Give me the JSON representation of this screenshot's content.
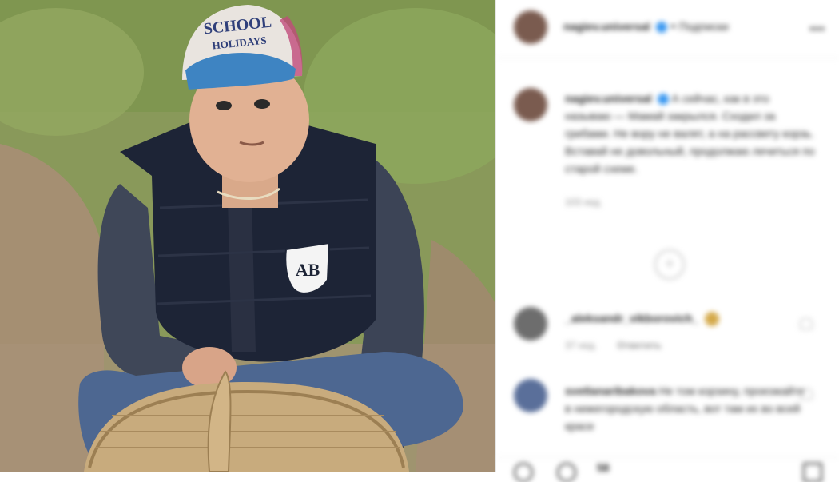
{
  "photo": {
    "cap_text_line1": "SCHOOL",
    "cap_text_line2": "HOLIDAYS",
    "vest_badge": "AB"
  },
  "header": {
    "username": "nagiev.universal",
    "separator": "•",
    "follow_label": "Подписки",
    "more_label": "•••"
  },
  "caption": {
    "username": "nagiev.universal",
    "text": "А сейчас, как в это называю — Мамай закрылся. Сходил за грибами. Не вору не валят, а на рассвету корзь. Вставай не довольный, продолжаю лечиться по старой схеме.",
    "time": "103 нед."
  },
  "load_more": "+",
  "comments": [
    {
      "username": "_aleksandr_vikborovich_",
      "text": "",
      "time": "37 нед.",
      "reply": "Ответить"
    },
    {
      "username": "svetlanaribakova",
      "text": "Не том корзину, проезжайте в нижегородскую область, вот там их во всей красе",
      "time": "",
      "reply": ""
    }
  ],
  "action_bar": {
    "likes_count": "58"
  }
}
